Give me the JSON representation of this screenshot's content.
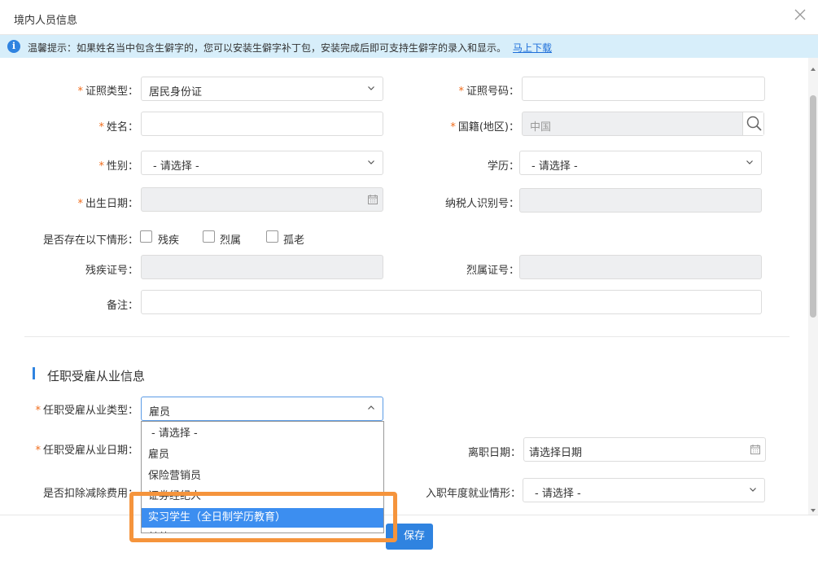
{
  "dialog": {
    "title": "境内人员信息"
  },
  "notice": {
    "text": "温馨提示：如果姓名当中包含生僻字的，您可以安装生僻字补丁包，安装完成后即可支持生僻字的录入和显示。",
    "link": "马上下载"
  },
  "form": {
    "id_type": {
      "label": "证照类型：",
      "value": "居民身份证"
    },
    "id_number": {
      "label": "证照号码：",
      "value": ""
    },
    "name": {
      "label": "姓名：",
      "value": ""
    },
    "nationality": {
      "label": "国籍(地区)：",
      "value": "中国"
    },
    "gender": {
      "label": "性别：",
      "value": "- 请选择 -"
    },
    "education": {
      "label": "学历：",
      "value": "- 请选择 -"
    },
    "birth_date": {
      "label": "出生日期：",
      "value": ""
    },
    "tax_id": {
      "label": "纳税人识别号：",
      "value": ""
    },
    "situations": {
      "label": "是否存在以下情形：",
      "options": [
        "残疾",
        "烈属",
        "孤老"
      ]
    },
    "disability_cert": {
      "label": "残疾证号：",
      "value": ""
    },
    "martyr_cert": {
      "label": "烈属证号：",
      "value": ""
    },
    "remark": {
      "label": "备注：",
      "value": ""
    }
  },
  "employment": {
    "section_title": "任职受雇从业信息",
    "type": {
      "label": "任职受雇从业类型：",
      "value": "雇员"
    },
    "start_date": {
      "label": "任职受雇从业日期："
    },
    "leave_date": {
      "label": "离职日期：",
      "placeholder": "请选择日期"
    },
    "deduct": {
      "label": "是否扣除减除费用："
    },
    "entry_status": {
      "label": "入职年度就业情形：",
      "value": "- 请选择 -"
    },
    "dropdown": {
      "options": [
        "- 请选择 -",
        "雇员",
        "保险营销员",
        "证券经纪人",
        "实习学生（全日制学历教育）",
        "其他"
      ],
      "selected_index": 4
    }
  },
  "footer": {
    "save_label": "保存"
  },
  "colors": {
    "accent": "#2f83e0",
    "required": "#f06b1a",
    "highlight": "#f5943c",
    "notice_bg": "#d7eefa"
  }
}
